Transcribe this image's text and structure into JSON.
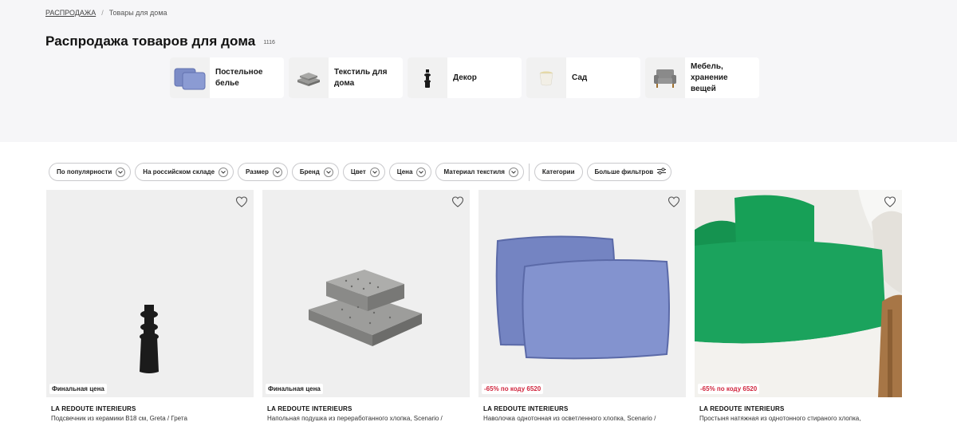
{
  "breadcrumb": {
    "root": "РАСПРОДАЖА",
    "separator": "/",
    "current": "Товары для дома"
  },
  "page": {
    "title": "Распродажа товаров для дома",
    "count": "1116"
  },
  "categories": [
    {
      "label": "Постельное белье",
      "icon": "pillow-icon"
    },
    {
      "label": "Текстиль для дома",
      "icon": "cushion-icon"
    },
    {
      "label": "Декор",
      "icon": "candlestick-icon"
    },
    {
      "label": "Сад",
      "icon": "planter-icon"
    },
    {
      "label": "Мебель, хранение вещей",
      "icon": "armchair-icon"
    }
  ],
  "filters": [
    "По популярности",
    "На российском складе",
    "Размер",
    "Бренд",
    "Цвет",
    "Цена",
    "Материал текстиля",
    "Категории",
    "Больше фильтров"
  ],
  "products": [
    {
      "brand": "LA REDOUTE INTERIEURS",
      "name": "Подсвечник из керамики B18 см, Greta / Грета",
      "badge": "Финальная цена",
      "badge_type": "final"
    },
    {
      "brand": "LA REDOUTE INTERIEURS",
      "name": "Напольная подушка из переработанного хлопка, Scenario /",
      "badge": "Финальная цена",
      "badge_type": "final"
    },
    {
      "brand": "LA REDOUTE INTERIEURS",
      "name": "Наволочка однотонная из осветленного хлопка, Scenario /",
      "badge": "-65% по коду 6520",
      "badge_type": "promo"
    },
    {
      "brand": "LA REDOUTE INTERIEURS",
      "name": "Простыня натяжная из однотонного стираного хлопка,",
      "badge": "-65% по коду 6520",
      "badge_type": "promo"
    }
  ],
  "colors": {
    "page_bg": "#f6f6f8",
    "promo": "#d0263e",
    "pillow": "#7c8cc6",
    "sheet": "#1f9b5a"
  }
}
